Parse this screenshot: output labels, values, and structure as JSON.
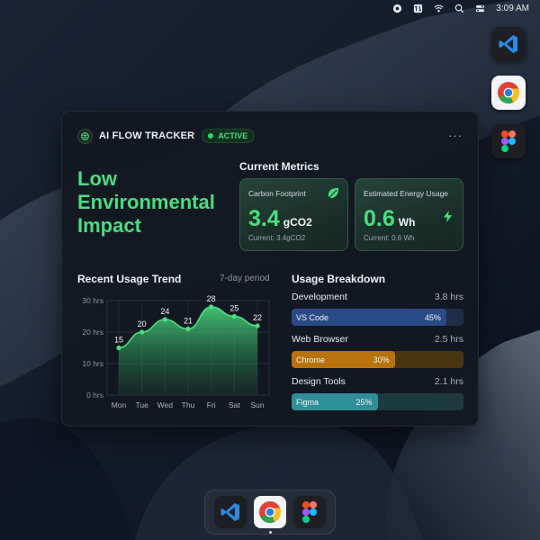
{
  "menubar": {
    "clock": "3:09 AM",
    "icons": [
      "record-icon",
      "transfer-icon",
      "wifi-icon",
      "search-icon",
      "control-center-icon"
    ]
  },
  "side_apps": [
    {
      "name": "vscode-icon"
    },
    {
      "name": "chrome-icon"
    },
    {
      "name": "figma-icon"
    }
  ],
  "widget": {
    "title": "AI FLOW TRACKER",
    "status": "ACTIVE",
    "more": "···",
    "impact_title": "Low Environmental Impact",
    "metrics_title": "Current Metrics",
    "metrics": [
      {
        "label": "Carbon Footprint",
        "value": "3.4",
        "unit": "gCO2",
        "sub": "Current: 3.4gCO2",
        "icon": "leaf-icon"
      },
      {
        "label": "Estimated Energy Usage",
        "value": "0.6",
        "unit": "Wh",
        "sub": "Current: 0.6 Wh",
        "icon": "lightning-icon"
      }
    ],
    "trend": {
      "title": "Recent Usage Trend",
      "period": "7-day period"
    },
    "breakdown": {
      "title": "Usage Breakdown",
      "items": [
        {
          "name": "Development",
          "hours": "3.8 hrs",
          "app": "VS Code",
          "percent": "45%",
          "fraction": 0.45,
          "color": "#2a4a86",
          "track": "#1d2d48"
        },
        {
          "name": "Web Browser",
          "hours": "2.5 hrs",
          "app": "Chrome",
          "percent": "30%",
          "fraction": 0.3,
          "color": "#b8730e",
          "track": "#4a3513"
        },
        {
          "name": "Design Tools",
          "hours": "2.1 hrs",
          "app": "Figma",
          "percent": "25%",
          "fraction": 0.25,
          "color": "#2f8f96",
          "track": "#1c3a3e"
        }
      ]
    }
  },
  "chart_data": {
    "type": "area",
    "categories": [
      "Mon",
      "Tue",
      "Wed",
      "Thu",
      "Fri",
      "Sat",
      "Sun"
    ],
    "values": [
      15,
      20,
      24,
      21,
      28,
      25,
      22
    ],
    "y_ticks": [
      "0 hrs",
      "10 hrs",
      "20 hrs",
      "30 hrs"
    ],
    "ylim": [
      0,
      30
    ],
    "grid": true,
    "color": "#4ade80"
  },
  "dock": {
    "apps": [
      {
        "name": "vscode-icon"
      },
      {
        "name": "chrome-icon"
      },
      {
        "name": "figma-icon"
      }
    ]
  }
}
